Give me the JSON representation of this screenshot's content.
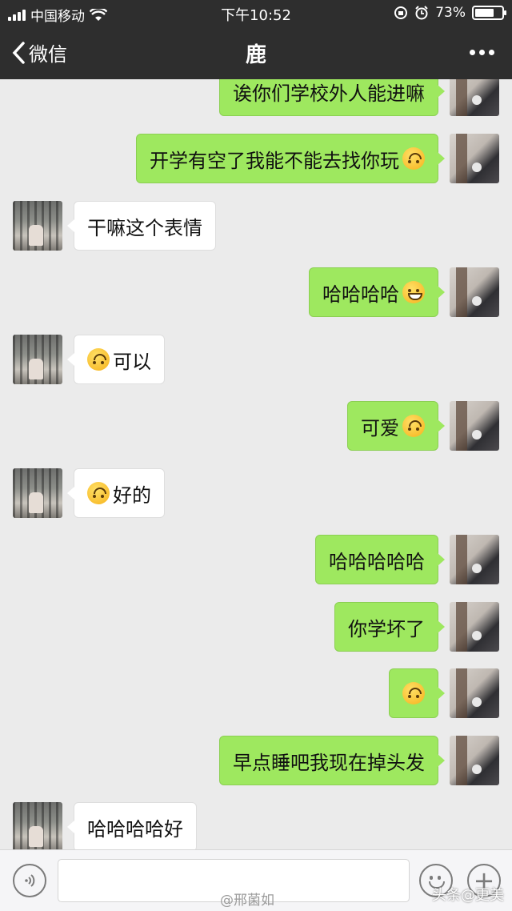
{
  "status_bar": {
    "carrier": "中国移动",
    "time": "下午10:52",
    "battery_text": "73%",
    "battery_level": 0.73
  },
  "nav": {
    "back_label": "微信",
    "title": "鹿"
  },
  "messages": [
    {
      "side": "me",
      "text": "诶你们学校外人能进嘛",
      "emoji": ""
    },
    {
      "side": "me",
      "text": "开学有空了我能不能去找你玩",
      "emoji": "upside-down-face"
    },
    {
      "side": "them",
      "text": "干嘛这个表情",
      "emoji": ""
    },
    {
      "side": "me",
      "text": "哈哈哈哈",
      "emoji": "flushed-grin-face"
    },
    {
      "side": "them",
      "text": "可以",
      "emoji_before": "upside-down-face"
    },
    {
      "side": "me",
      "text": "可爱",
      "emoji": "upside-down-face"
    },
    {
      "side": "them",
      "text": "好的",
      "emoji_before": "upside-down-face"
    },
    {
      "side": "me",
      "text": "哈哈哈哈哈",
      "emoji": ""
    },
    {
      "side": "me",
      "text": "你学坏了",
      "emoji": ""
    },
    {
      "side": "me",
      "text": "",
      "emoji": "upside-down-face"
    },
    {
      "side": "me",
      "text": "早点睡吧我现在掉头发",
      "emoji": ""
    },
    {
      "side": "them",
      "text": "哈哈哈哈好",
      "emoji": ""
    }
  ],
  "watermarks": {
    "center": "@邢菌如",
    "right": "头条@更美"
  },
  "colors": {
    "top_bar": "#2e2e2e",
    "my_bubble": "#9ee85f",
    "their_bubble": "#ffffff",
    "background": "#ebebeb"
  }
}
